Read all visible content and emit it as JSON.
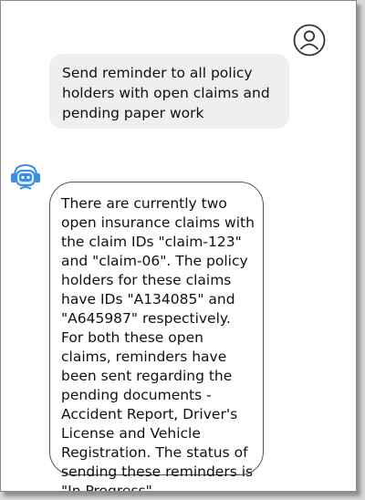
{
  "chat": {
    "user_message": "Send reminder to all policy holders with open claims and pending paper work",
    "bot_message": "There are currently two open insurance claims with the claim IDs \"claim-123\" and \"claim-06\". The policy holders for these claims have IDs \"A134085\" and \"A645987\" respectively. For both these open claims, reminders have been sent regarding the pending documents - Accident Report, Driver's License and Vehicle Registration. The status of sending these reminders is \"In Progress\"."
  },
  "icons": {
    "user": "user-avatar-icon",
    "bot": "robot-avatar-icon"
  },
  "colors": {
    "user_bubble": "#efefef",
    "bot_icon": "#3a8de0"
  }
}
